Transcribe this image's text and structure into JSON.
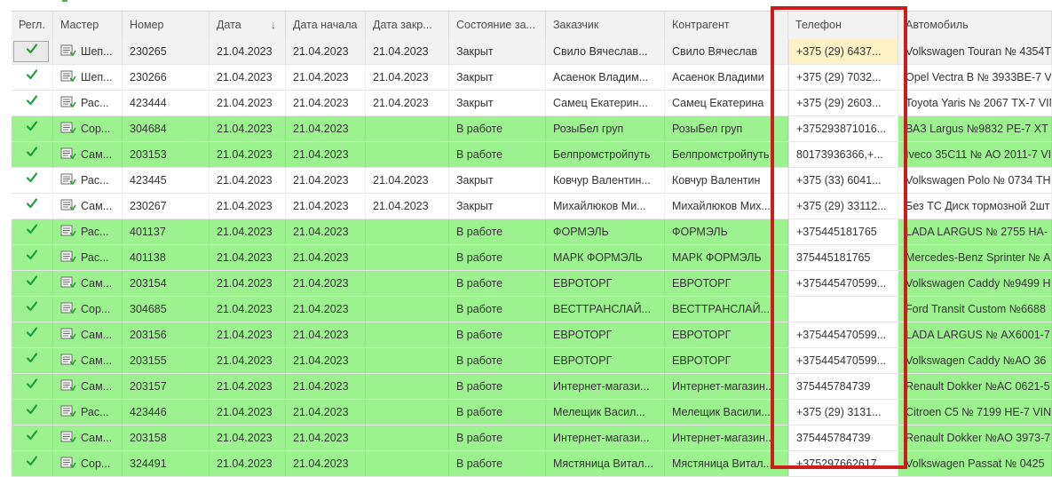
{
  "columns": [
    {
      "key": "regl",
      "label": "Регл."
    },
    {
      "key": "master",
      "label": "Мастер"
    },
    {
      "key": "number",
      "label": "Номер"
    },
    {
      "key": "date",
      "label": "Дата",
      "sort": "↓"
    },
    {
      "key": "date_start",
      "label": "Дата начала"
    },
    {
      "key": "date_close",
      "label": "Дата закр..."
    },
    {
      "key": "state",
      "label": "Состояние за..."
    },
    {
      "key": "customer",
      "label": "Заказчик"
    },
    {
      "key": "contractor",
      "label": "Контрагент"
    },
    {
      "key": "phone",
      "label": "Телефон"
    },
    {
      "key": "car",
      "label": "Автомобиль"
    }
  ],
  "colors": {
    "green_row": "#9cf28e",
    "highlight_border": "#cc1d1d",
    "check": "#1a9e3a",
    "selected_phone": "#fdf2c6"
  },
  "rows": [
    {
      "status": "white",
      "selected": true,
      "master": "Шеп...",
      "number": "230265",
      "date": "21.04.2023",
      "date_start": "21.04.2023",
      "date_close": "21.04.2023",
      "state": "Закрыт",
      "customer": "Свило Вячеслав...",
      "contractor": "Свило Вячеслав",
      "phone": "+375 (29) 6437...",
      "car": "Volkswagen Touran № 4354T"
    },
    {
      "status": "white",
      "master": "Шеп...",
      "number": "230266",
      "date": "21.04.2023",
      "date_start": "21.04.2023",
      "date_close": "21.04.2023",
      "state": "Закрыт",
      "customer": "Асаенок Владим...",
      "contractor": "Асаенок Владими",
      "phone": "+375 (29) 7032...",
      "car": "Opel Vectra B № 3933ВЕ-7 VI"
    },
    {
      "status": "white",
      "master": "Рас...",
      "number": "423444",
      "date": "21.04.2023",
      "date_start": "21.04.2023",
      "date_close": "21.04.2023",
      "state": "Закрыт",
      "customer": "Самец Екатерин...",
      "contractor": "Самец Екатерина",
      "phone": "+375 (29) 2603...",
      "car": "Toyota Yaris № 2067 ТХ-7 VIN"
    },
    {
      "status": "green",
      "master": "Сор...",
      "number": "304684",
      "date": "21.04.2023",
      "date_start": "21.04.2023",
      "date_close": "",
      "state": "В работе",
      "customer": "РозыБел груп",
      "contractor": "РозыБел груп",
      "phone": "+375293871016...",
      "car": "ВАЗ Largus №9832 РЕ-7 ХТ"
    },
    {
      "status": "green",
      "master": "Сам...",
      "number": "203153",
      "date": "21.04.2023",
      "date_start": "21.04.2023",
      "date_close": "",
      "state": "В работе",
      "customer": "Белпромстройпуть",
      "contractor": "Белпромстройпуть",
      "phone": "80173936366,+...",
      "car": "Iveco 35C11 № АО 2011-7 VI"
    },
    {
      "status": "white",
      "master": "Рас...",
      "number": "423445",
      "date": "21.04.2023",
      "date_start": "21.04.2023",
      "date_close": "21.04.2023",
      "state": "Закрыт",
      "customer": "Ковчур Валентин...",
      "contractor": "Ковчур Валентин",
      "phone": "+375 (33) 6041...",
      "car": "Volkswagen Polo № 0734 ТН"
    },
    {
      "status": "white",
      "master": "Сам...",
      "number": "230267",
      "date": "21.04.2023",
      "date_start": "21.04.2023",
      "date_close": "21.04.2023",
      "state": "Закрыт",
      "customer": "Михайлюков Ми...",
      "contractor": "Михайлюков Мих...",
      "phone": "+375 (29) 33112...",
      "car": "Без ТС Диск тормозной 2шт"
    },
    {
      "status": "green",
      "master": "Рас...",
      "number": "401137",
      "date": "21.04.2023",
      "date_start": "21.04.2023",
      "date_close": "",
      "state": "В работе",
      "customer": "ФОРМЭЛЬ",
      "contractor": "ФОРМЭЛЬ",
      "phone": "+375445181765",
      "car": "LADA LARGUS № 2755 НА-"
    },
    {
      "status": "green",
      "master": "Рас...",
      "number": "401138",
      "date": "21.04.2023",
      "date_start": "21.04.2023",
      "date_close": "",
      "state": "В работе",
      "customer": "МАРК ФОРМЭЛЬ",
      "contractor": "МАРК ФОРМЭЛЬ",
      "phone": "375445181765",
      "car": "Mercedes-Benz Sprinter № А"
    },
    {
      "status": "green",
      "master": "Сам...",
      "number": "203154",
      "date": "21.04.2023",
      "date_start": "21.04.2023",
      "date_close": "",
      "state": "В работе",
      "customer": "ЕВРОТОРГ",
      "contractor": "ЕВРОТОРГ",
      "phone": "+375445470599...",
      "car": "Volkswagen Caddy №9499 Н"
    },
    {
      "status": "green",
      "master": "Сор...",
      "number": "304685",
      "date": "21.04.2023",
      "date_start": "21.04.2023",
      "date_close": "",
      "state": "В работе",
      "customer": "ВЕСТТРАНСЛАЙ...",
      "contractor": "ВЕСТТРАНСЛАЙ...",
      "phone": "",
      "car": "Ford Transit Custom №6688"
    },
    {
      "status": "green",
      "master": "Сам...",
      "number": "203156",
      "date": "21.04.2023",
      "date_start": "21.04.2023",
      "date_close": "",
      "state": "В работе",
      "customer": "ЕВРОТОРГ",
      "contractor": "ЕВРОТОРГ",
      "phone": "+375445470599...",
      "car": "LADA LARGUS № АХ6001-7"
    },
    {
      "status": "green",
      "master": "Сам...",
      "number": "203155",
      "date": "21.04.2023",
      "date_start": "21.04.2023",
      "date_close": "",
      "state": "В работе",
      "customer": "ЕВРОТОРГ",
      "contractor": "ЕВРОТОРГ",
      "phone": "+375445470599...",
      "car": "Volkswagen Caddy №АО 36"
    },
    {
      "status": "green",
      "master": "Сам...",
      "number": "203157",
      "date": "21.04.2023",
      "date_start": "21.04.2023",
      "date_close": "",
      "state": "В работе",
      "customer": "Интернет-магази...",
      "contractor": "Интернет-магазин...",
      "phone": "375445784739",
      "car": "Renault Dokker №АС 0621-5"
    },
    {
      "status": "green",
      "master": "Рас...",
      "number": "423446",
      "date": "21.04.2023",
      "date_start": "21.04.2023",
      "date_close": "",
      "state": "В работе",
      "customer": "Мелещик Васил...",
      "contractor": "Мелещик Васили...",
      "phone": "+375 (29) 3131...",
      "car": "Citroen C5 № 7199 НЕ-7 VIN"
    },
    {
      "status": "green",
      "master": "Сам...",
      "number": "203158",
      "date": "21.04.2023",
      "date_start": "21.04.2023",
      "date_close": "",
      "state": "В работе",
      "customer": "Интернет-магази...",
      "contractor": "Интернет-магазин...",
      "phone": "375445784739",
      "car": "Renault Dokker №АО 3973-7"
    },
    {
      "status": "green",
      "master": "Сор...",
      "number": "324491",
      "date": "21.04.2023",
      "date_start": "21.04.2023",
      "date_close": "",
      "state": "В работе",
      "customer": "Мястяница Витал...",
      "contractor": "Мястяница Витал...",
      "phone": "+375297662617",
      "car": "Volkswagen Passat № 0425"
    }
  ]
}
